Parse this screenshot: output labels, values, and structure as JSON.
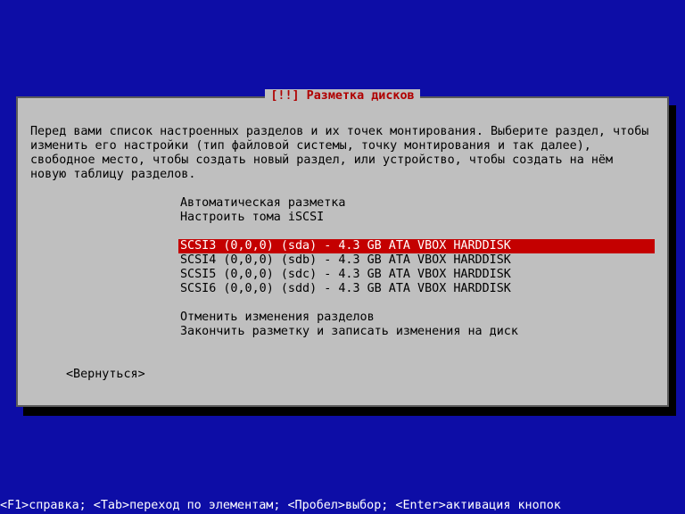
{
  "dialog": {
    "title": "[!!] Разметка дисков",
    "intro": "Перед вами список настроенных разделов и их точек монтирования. Выберите раздел, чтобы изменить его настройки (тип файловой системы, точку монтирования и так далее), свободное место, чтобы создать новый раздел, или устройство, чтобы создать на нём новую таблицу разделов.",
    "menu_top": [
      "Автоматическая разметка",
      "Настроить тома iSCSI"
    ],
    "disks": [
      {
        "label": "SCSI3 (0,0,0) (sda) - 4.3 GB ATA VBOX HARDDISK",
        "selected": true
      },
      {
        "label": "SCSI4 (0,0,0) (sdb) - 4.3 GB ATA VBOX HARDDISK",
        "selected": false
      },
      {
        "label": "SCSI5 (0,0,0) (sdc) - 4.3 GB ATA VBOX HARDDISK",
        "selected": false
      },
      {
        "label": "SCSI6 (0,0,0) (sdd) - 4.3 GB ATA VBOX HARDDISK",
        "selected": false
      }
    ],
    "menu_bottom": [
      "Отменить изменения разделов",
      "Закончить разметку и записать изменения на диск"
    ],
    "back": "<Вернуться>"
  },
  "footer": "<F1>справка; <Tab>переход по элементам; <Пробел>выбор; <Enter>активация кнопок"
}
